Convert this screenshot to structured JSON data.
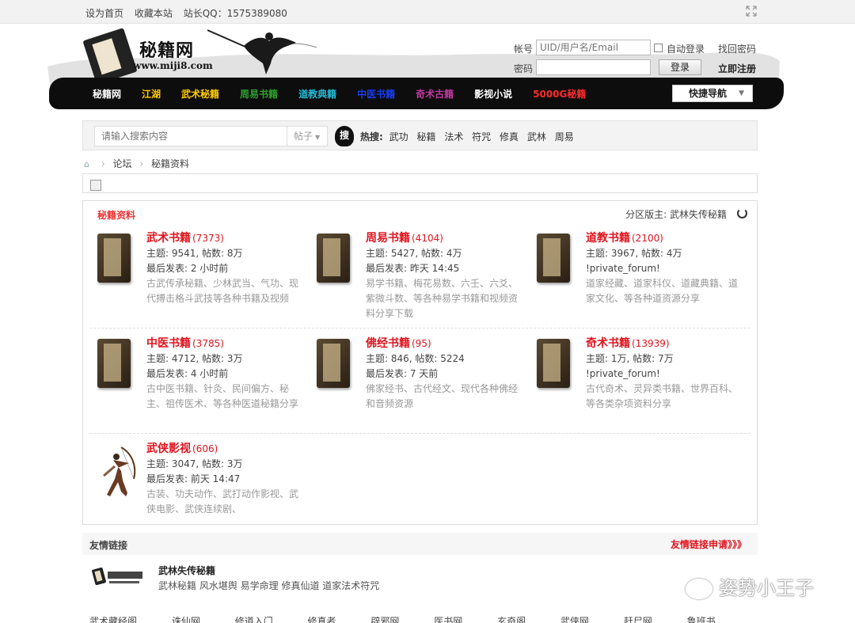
{
  "topbar": {
    "set_home": "设为首页",
    "bookmark": "收藏本站",
    "qq": "站长QQ：1575389080"
  },
  "logo": {
    "name": "秘籍网",
    "url": "www.miji8.com"
  },
  "login": {
    "account_label": "帐号",
    "account_placeholder": "UID/用户名/Email",
    "auto_login": "自动登录",
    "find_password": "找回密码",
    "password_label": "密码",
    "login_button": "登录",
    "register": "立即注册"
  },
  "nav": {
    "items": [
      {
        "label": "秘籍网",
        "color": "#ffffff"
      },
      {
        "label": "江湖",
        "color": "#ffcc00"
      },
      {
        "label": "武术秘籍",
        "color": "#ffcc00"
      },
      {
        "label": "周易书籍",
        "color": "#2ea02e"
      },
      {
        "label": "道教典籍",
        "color": "#22bbd6"
      },
      {
        "label": "中医书籍",
        "color": "#1a3cf0"
      },
      {
        "label": "奇术古籍",
        "color": "#c03aa0"
      },
      {
        "label": "影视小说",
        "color": "#ffffff"
      },
      {
        "label": "5000G秘籍",
        "color": "#ff2a2a"
      }
    ],
    "quick_nav": "快捷导航"
  },
  "search": {
    "placeholder": "请输入搜索内容",
    "type": "帖子",
    "button": "搜",
    "hot_label": "热搜:",
    "hot": [
      "武功",
      "秘籍",
      "法术",
      "符咒",
      "修真",
      "武林",
      "周易"
    ]
  },
  "breadcrumb": {
    "forum": "论坛",
    "current": "秘籍资料"
  },
  "section": {
    "title": "秘籍资料",
    "moderator": "分区版主: 武林失传秘籍"
  },
  "forums": [
    {
      "name": "武术书籍",
      "count": "(7373)",
      "stats": "主题: 9541, 帖数: 8万",
      "last": "最后发表: 2 小时前",
      "desc": "古武传承秘籍、少林武当、气功、现代搏击格斗武技等各种书籍及视频"
    },
    {
      "name": "周易书籍",
      "count": "(4104)",
      "stats": "主题: 5427, 帖数: 4万",
      "last": "最后发表: 昨天 14:45",
      "desc": "易学书籍、梅花易数、六壬、六爻、紫微斗数、等各种易学书籍和视频资料分享下载"
    },
    {
      "name": "道教书籍",
      "count": "(2100)",
      "stats": "主题: 3967, 帖数: 4万",
      "last": "!private_forum!",
      "desc": "道家经藏、道家科仪、道藏典籍、道家文化、等各种道资源分享"
    },
    {
      "name": "中医书籍",
      "count": "(3785)",
      "stats": "主题: 4712, 帖数: 3万",
      "last": "最后发表: 4 小时前",
      "desc": "古中医书籍、针灸、民间偏方、秘主、祖传医术、等各种医道秘籍分享"
    },
    {
      "name": "佛经书籍",
      "count": "(95)",
      "stats": "主题: 846, 帖数: 5224",
      "last": "最后发表: 7 天前",
      "desc": "佛家经书、古代经文、现代各种佛经和音频资源"
    },
    {
      "name": "奇术书籍",
      "count": "(13939)",
      "stats": "主题: 1万, 帖数: 7万",
      "last": "!private_forum!",
      "desc": "古代奇术、灵异类书籍、世界百科、等各类杂项资料分享"
    },
    {
      "name": "武侠影视",
      "count": "(606)",
      "stats": "主题: 3047, 帖数: 3万",
      "last": "最后发表: 前天 14:47",
      "desc": "古装、功夫动作、武打动作影视、武侠电影、武侠连续剧、"
    }
  ],
  "friends": {
    "title": "友情链接",
    "apply": "友情链接申请》》》",
    "site_name": "武林失传秘籍",
    "site_desc": "武林秘籍 风水堪舆 易学命理 修真仙道 道家法术符咒"
  },
  "watermark": "姿势小王子",
  "bottom_links": [
    "武术藏经阁",
    "诛仙网",
    "修道入门",
    "修真者",
    "辟邪网",
    "医书网",
    "玄奇阁",
    "武侠网",
    "赶尸网",
    "鲁班书"
  ]
}
